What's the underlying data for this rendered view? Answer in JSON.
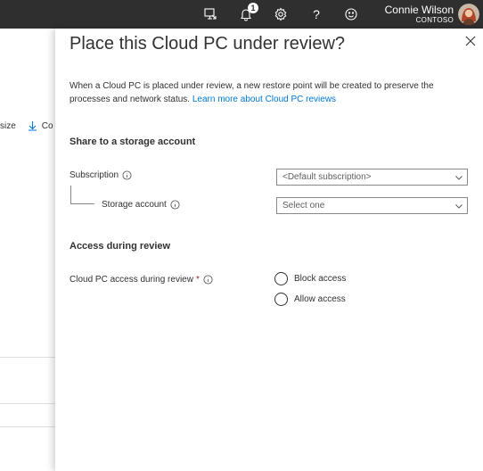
{
  "header": {
    "user_name": "Connie Wilson",
    "user_org": "CONTOSO",
    "notification_count": "1",
    "help_glyph": "?"
  },
  "background": {
    "toolbar_partial_left": "size",
    "toolbar_partial_right": "Co"
  },
  "panel": {
    "title": "Place this Cloud PC under review?",
    "description": "When a Cloud PC is placed under review, a new restore point will be created to preserve the processes and network status.",
    "learn_more_link": "Learn more about Cloud PC reviews",
    "storage_section_heading": "Share to a storage account",
    "subscription_label": "Subscription",
    "subscription_value": "<Default subscription>",
    "storage_account_label": "Storage account",
    "storage_account_placeholder": "Select one",
    "access_section_heading": "Access during review",
    "access_label": "Cloud PC access during review",
    "required_marker": "*",
    "options": [
      {
        "label": "Block access"
      },
      {
        "label": "Allow access"
      }
    ]
  }
}
